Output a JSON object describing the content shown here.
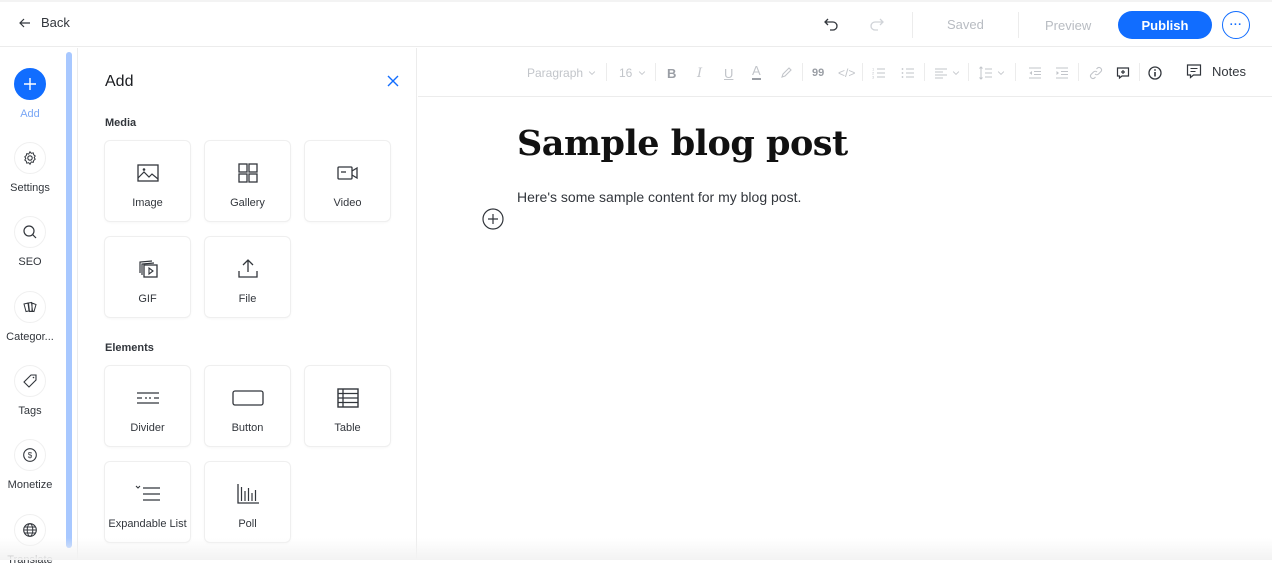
{
  "topbar": {
    "back_label": "Back",
    "saved_label": "Saved",
    "preview_label": "Preview",
    "publish_label": "Publish",
    "more_label": "···",
    "accent_color": "#116dff"
  },
  "rail": {
    "items": [
      {
        "label": "Add",
        "icon": "plus-icon",
        "active": true
      },
      {
        "label": "Settings",
        "icon": "gear-icon"
      },
      {
        "label": "SEO",
        "icon": "search-icon"
      },
      {
        "label": "Categor...",
        "icon": "categories-icon"
      },
      {
        "label": "Tags",
        "icon": "tag-icon"
      },
      {
        "label": "Monetize",
        "icon": "dollar-icon"
      },
      {
        "label": "Translate",
        "icon": "globe-icon"
      }
    ]
  },
  "panel": {
    "title": "Add",
    "sections": [
      {
        "label": "Media",
        "tiles": [
          {
            "label": "Image",
            "icon": "image-icon"
          },
          {
            "label": "Gallery",
            "icon": "gallery-icon"
          },
          {
            "label": "Video",
            "icon": "video-icon"
          },
          {
            "label": "GIF",
            "icon": "gif-icon"
          },
          {
            "label": "File",
            "icon": "upload-icon"
          }
        ]
      },
      {
        "label": "Elements",
        "tiles": [
          {
            "label": "Divider",
            "icon": "divider-icon"
          },
          {
            "label": "Button",
            "icon": "button-icon"
          },
          {
            "label": "Table",
            "icon": "table-icon"
          },
          {
            "label": "Expandable List",
            "icon": "expandable-list-icon"
          },
          {
            "label": "Poll",
            "icon": "poll-icon"
          }
        ]
      }
    ]
  },
  "toolbar": {
    "paragraph_style": "Paragraph",
    "font_size": "16",
    "bold_label": "B",
    "italic_label": "I",
    "underline_label": "U",
    "color_label": "A",
    "quote_label": "99",
    "code_label": "</>",
    "notes_label": "Notes"
  },
  "editor": {
    "title": "Sample blog post",
    "body": "Here's some sample content for my blog post."
  }
}
